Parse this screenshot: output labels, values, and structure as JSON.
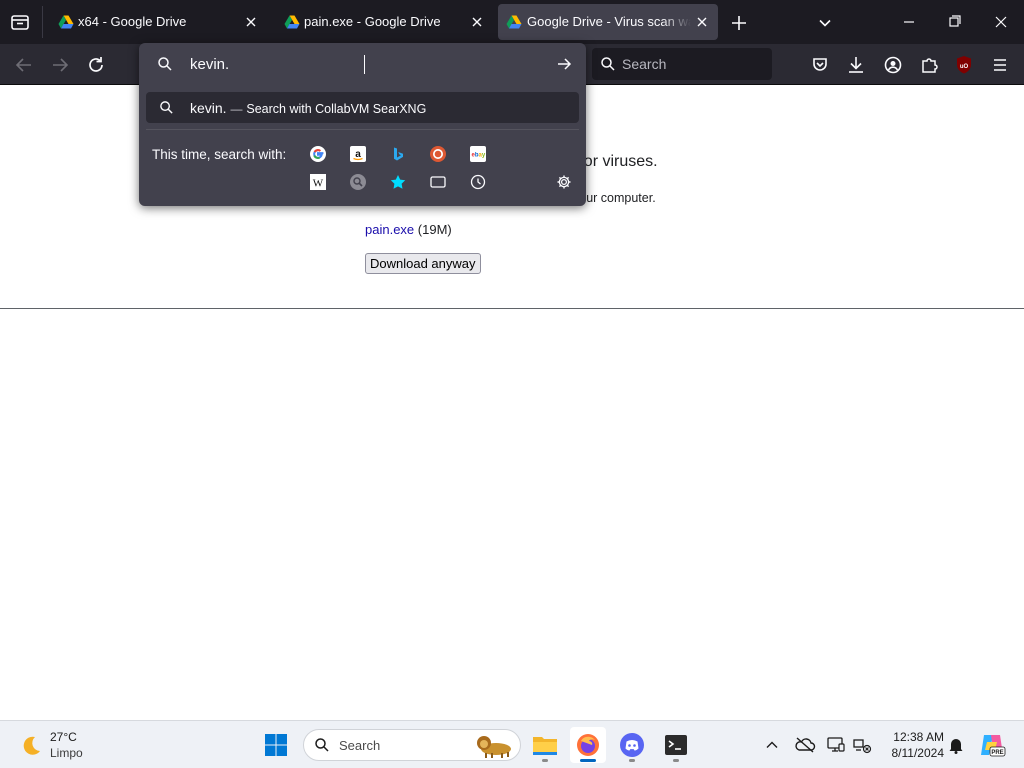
{
  "browser": {
    "tabs": [
      {
        "title": "x64 - Google Drive",
        "active": false
      },
      {
        "title": "pain.exe - Google Drive",
        "active": false
      },
      {
        "title": "Google Drive - Virus scan warning",
        "active": true
      }
    ],
    "search_placeholder": "Search"
  },
  "urlbar": {
    "value": "kevin.",
    "result": {
      "query": "kevin.",
      "separator": "—",
      "engine_text": "Search with CollabVM SearXNG"
    },
    "oneoff_label": "This time, search with:",
    "engines": [
      "google-icon",
      "amazon-icon",
      "bing-icon",
      "duckduckgo-icon",
      "ebay-icon",
      "wikipedia-icon",
      "search-engine-icon",
      "bookmarks-icon",
      "tabs-icon",
      "history-icon"
    ]
  },
  "page": {
    "heading_fragment": "e for viruses.",
    "sub_fragment": "your computer.",
    "file_link": "pain.exe",
    "file_size": "(19M)",
    "download_button": "Download anyway"
  },
  "taskbar": {
    "weather_temp": "27°C",
    "weather_desc": "Limpo",
    "search_label": "Search",
    "time": "12:38 AM",
    "date": "8/11/2024"
  },
  "colors": {
    "link": "#1a0dab",
    "tab_bg": "#1c1b22",
    "toolbar_bg": "#2b2a33",
    "popup_bg": "#42414d"
  }
}
